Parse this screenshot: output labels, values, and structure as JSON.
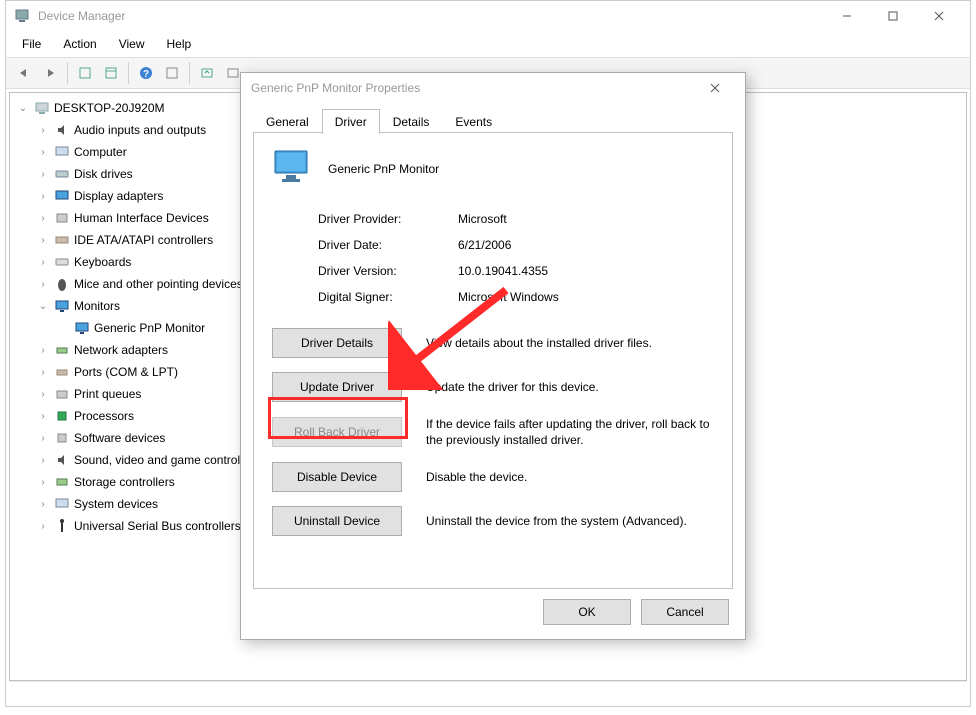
{
  "window": {
    "title": "Device Manager",
    "menus": [
      "File",
      "Action",
      "View",
      "Help"
    ]
  },
  "tree": {
    "root": "DESKTOP-20J920M",
    "items": [
      "Audio inputs and outputs",
      "Computer",
      "Disk drives",
      "Display adapters",
      "Human Interface Devices",
      "IDE ATA/ATAPI controllers",
      "Keyboards",
      "Mice and other pointing devices",
      "Monitors",
      "Generic PnP Monitor",
      "Network adapters",
      "Ports (COM & LPT)",
      "Print queues",
      "Processors",
      "Software devices",
      "Sound, video and game controllers",
      "Storage controllers",
      "System devices",
      "Universal Serial Bus controllers"
    ]
  },
  "dialog": {
    "title": "Generic PnP Monitor Properties",
    "tabs": [
      "General",
      "Driver",
      "Details",
      "Events"
    ],
    "device_name": "Generic PnP Monitor",
    "info": {
      "provider_label": "Driver Provider:",
      "provider_value": "Microsoft",
      "date_label": "Driver Date:",
      "date_value": "6/21/2006",
      "version_label": "Driver Version:",
      "version_value": "10.0.19041.4355",
      "signer_label": "Digital Signer:",
      "signer_value": "Microsoft Windows"
    },
    "actions": {
      "details_btn": "Driver Details",
      "details_desc": "View details about the installed driver files.",
      "update_btn": "Update Driver",
      "update_desc": "Update the driver for this device.",
      "rollback_btn": "Roll Back Driver",
      "rollback_desc": "If the device fails after updating the driver, roll back to the previously installed driver.",
      "disable_btn": "Disable Device",
      "disable_desc": "Disable the device.",
      "uninstall_btn": "Uninstall Device",
      "uninstall_desc": "Uninstall the device from the system (Advanced)."
    },
    "ok": "OK",
    "cancel": "Cancel"
  }
}
